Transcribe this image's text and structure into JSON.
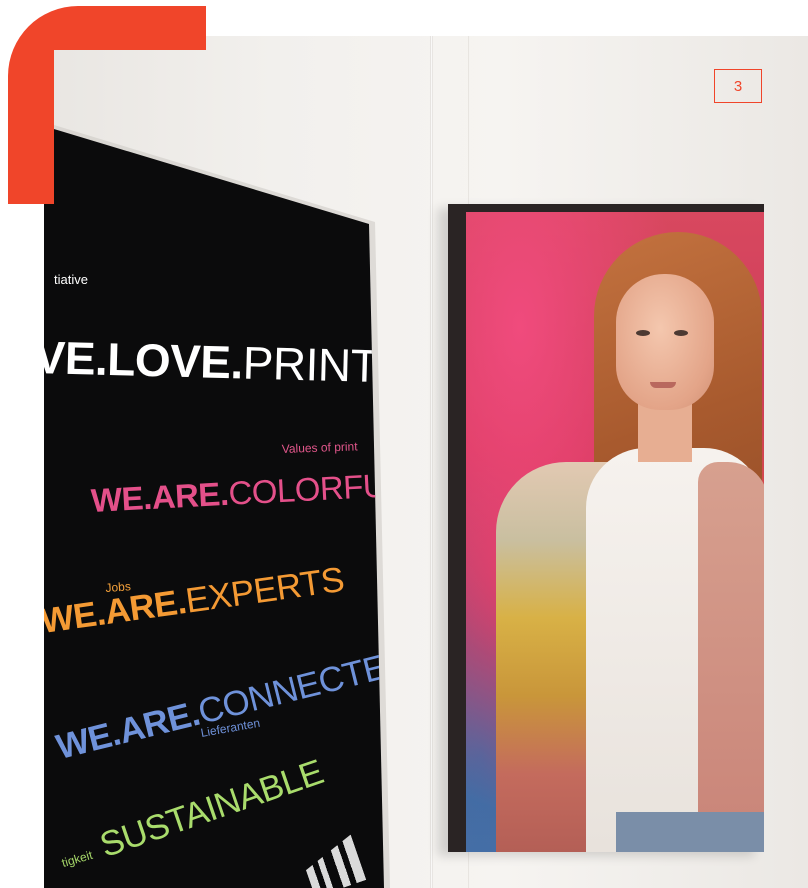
{
  "page": {
    "number": "3",
    "accent_color": "#f0452a"
  },
  "poster": {
    "background": "#0b0b0c",
    "initiative_label": "tiative",
    "headline_bold": "VE.LOVE.",
    "headline_regular": "PRINT",
    "lines": [
      {
        "label": "Values of print",
        "bold": "WE.ARE.",
        "regular": "COLORFUL",
        "color": "#e4508a"
      },
      {
        "label": "Jobs",
        "bold": "WE.ARE.",
        "regular": "EXPERTS",
        "color": "#f49a34"
      },
      {
        "label": "Lieferanten",
        "bold": "WE.ARE.",
        "regular": "CONNECTED",
        "color": "#6f92da"
      },
      {
        "label": "tigkeit",
        "bold": "",
        "regular": "SUSTAINABLE",
        "color": "#a9dc6c"
      }
    ]
  },
  "framed_photo": {
    "subject": "portrait-photo"
  }
}
